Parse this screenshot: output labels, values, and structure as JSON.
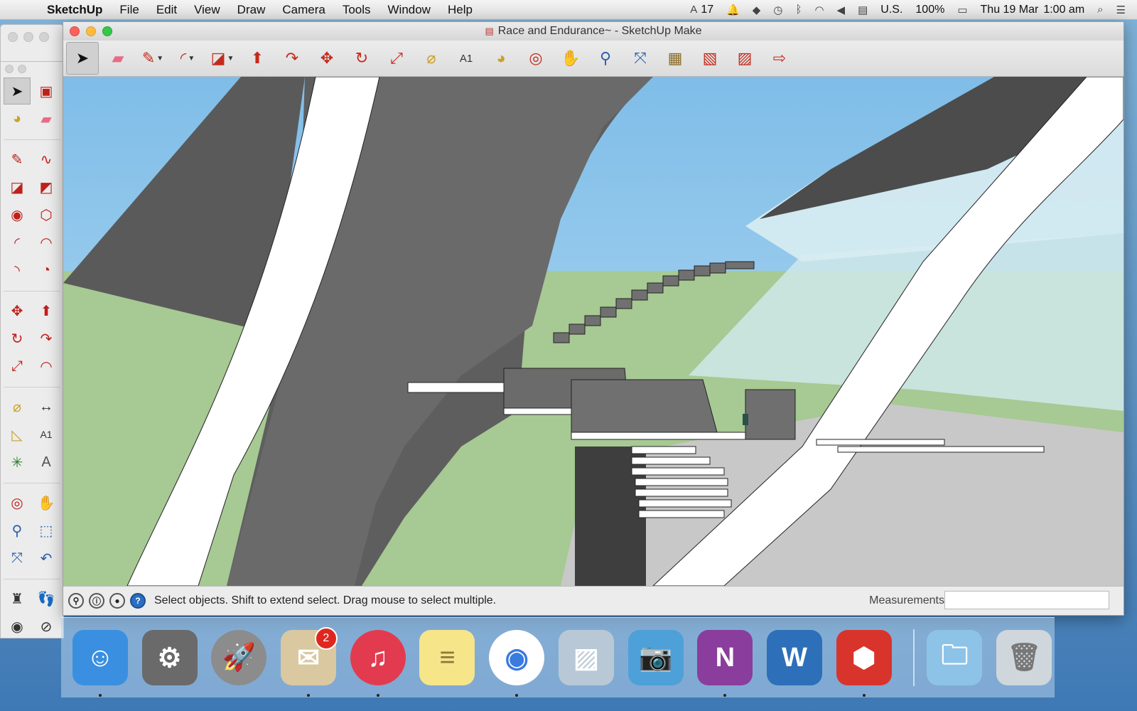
{
  "menubar": {
    "app_name": "SketchUp",
    "menus": [
      "File",
      "Edit",
      "View",
      "Draw",
      "Camera",
      "Tools",
      "Window",
      "Help"
    ],
    "status_items": [
      "17",
      "U.S.",
      "100%",
      "Thu 19 Mar",
      "1:00 am"
    ]
  },
  "window": {
    "title": "Race and Endurance~ - SketchUp Make"
  },
  "toolbar": {
    "tools": [
      "select-tool",
      "eraser-tool",
      "pencil-tool",
      "arc-tool",
      "rectangle-tool",
      "push-pull-tool",
      "offset-tool",
      "move-tool",
      "rotate-tool",
      "scale-tool",
      "tape-measure-tool",
      "text-tool",
      "paint-bucket-tool",
      "orbit-tool",
      "pan-tool",
      "zoom-tool",
      "zoom-extents-tool",
      "3d-warehouse-tool",
      "extension-warehouse-tool",
      "layout-send-tool",
      "share-model-tool"
    ]
  },
  "palette": {
    "tools": [
      "select",
      "component",
      "paint",
      "eraser",
      "line",
      "freehand",
      "rectangle",
      "rotated-rectangle",
      "circle",
      "polygon",
      "arc",
      "2-point-arc",
      "3-point-arc",
      "pie",
      "move",
      "push-pull",
      "rotate",
      "follow-me",
      "scale",
      "offset",
      "tape-measure",
      "dimensions",
      "protractor",
      "text",
      "axes",
      "3d-text",
      "orbit",
      "pan",
      "zoom",
      "zoom-window",
      "zoom-extents",
      "previous",
      "position-camera",
      "walk",
      "look-around",
      "section-plane"
    ]
  },
  "statusbar": {
    "hint": "Select objects. Shift to extend select. Drag mouse to select multiple.",
    "measurements_label": "Measurements",
    "measurements_value": ""
  },
  "dock": {
    "apps": [
      {
        "name": "Finder",
        "color": "#3a8fe0"
      },
      {
        "name": "System Preferences",
        "color": "#6a6a6a"
      },
      {
        "name": "Launchpad",
        "color": "#8c8c8c"
      },
      {
        "name": "Mail",
        "color": "#d9c8a0",
        "badge": "2"
      },
      {
        "name": "iTunes",
        "color": "#e23b4f"
      },
      {
        "name": "Notes",
        "color": "#f7e58a"
      },
      {
        "name": "Chrome",
        "color": "#ffffff"
      },
      {
        "name": "Preview",
        "color": "#b9c8d6"
      },
      {
        "name": "iPhoto",
        "color": "#4ea0d8"
      },
      {
        "name": "OneNote",
        "color": "#8a3d9c"
      },
      {
        "name": "Word",
        "color": "#2d6fb8"
      },
      {
        "name": "SketchUp",
        "color": "#d8342b"
      },
      {
        "name": "Documents",
        "color": "#8ec3e8"
      },
      {
        "name": "Trash",
        "color": "#cfd6dc"
      }
    ]
  }
}
